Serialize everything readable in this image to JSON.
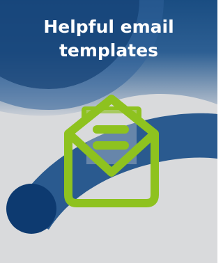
{
  "card": {
    "title_line1": "Helpful email",
    "title_line2": "templates",
    "icon": "open-envelope-icon"
  },
  "colors": {
    "navy": "#1d4a7c",
    "deep_navy": "#0d3a70",
    "light_gray": "#d9d9d9",
    "lime": "#8ec21f",
    "white": "#ffffff"
  }
}
